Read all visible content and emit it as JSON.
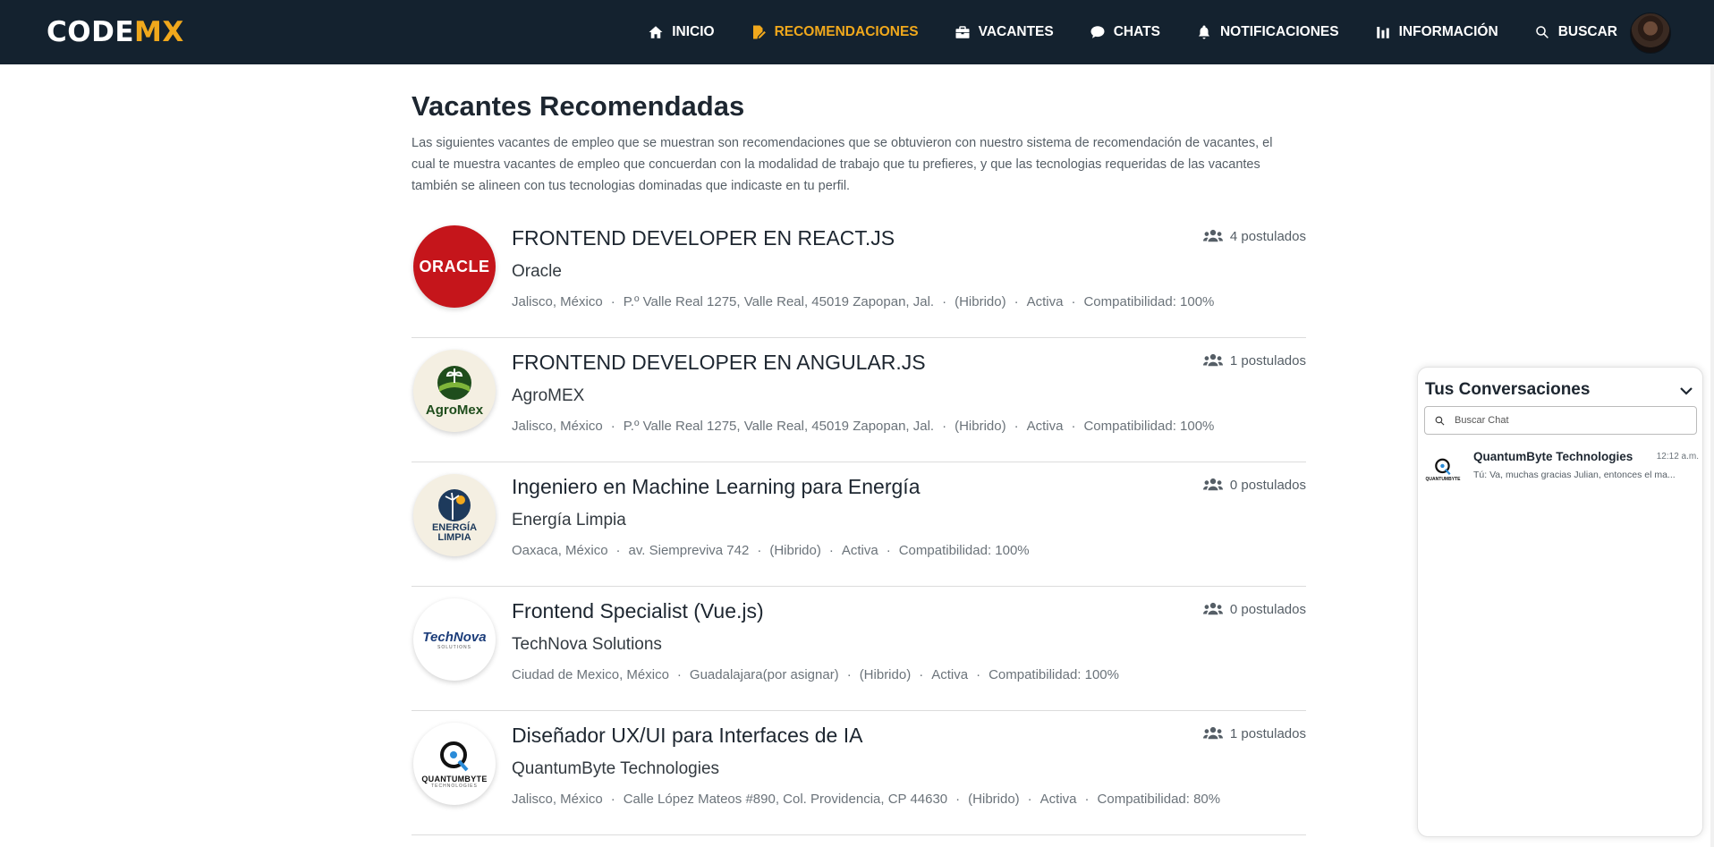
{
  "brand": {
    "part1": "CODE",
    "part2": "MX"
  },
  "nav": [
    {
      "label": "INICIO",
      "icon": "home-icon",
      "active": false
    },
    {
      "label": "RECOMENDACIONES",
      "icon": "edit-doc-icon",
      "active": true
    },
    {
      "label": "VACANTES",
      "icon": "briefcase-icon",
      "active": false
    },
    {
      "label": "CHATS",
      "icon": "chat-bubble-icon",
      "active": false
    },
    {
      "label": "NOTIFICACIONES",
      "icon": "bell-icon",
      "active": false
    },
    {
      "label": "INFORMACIÓN",
      "icon": "bar-chart-icon",
      "active": false
    },
    {
      "label": "BUSCAR",
      "icon": "search-icon",
      "active": false
    }
  ],
  "page": {
    "title": "Vacantes Recomendadas",
    "description": "Las siguientes vacantes de empleo que se muestran son recomendaciones que se obtuvieron con nuestro sistema de recomendación de vacantes, el cual te muestra vacantes de empleo que concuerdan con la modalidad de trabajo que tu prefieres, y que las tecnologias requeridas de las vacantes también se alineen con tus tecnologias dominadas que indicaste en tu perfil."
  },
  "jobs": [
    {
      "title": "FRONTEND DEVELOPER EN REACT.JS",
      "company": "Oracle",
      "location": "Jalisco, México",
      "address": "P.º Valle Real 1275, Valle Real, 45019 Zapopan, Jal.",
      "modality": "(Hibrido)",
      "status": "Activa",
      "compat": "Compatibilidad: 100%",
      "applicants": "4 postulados",
      "logo_text": "ORACLE"
    },
    {
      "title": "FRONTEND DEVELOPER EN ANGULAR.JS",
      "company": "AgroMEX",
      "location": "Jalisco, México",
      "address": "P.º Valle Real 1275, Valle Real, 45019 Zapopan, Jal.",
      "modality": "(Hibrido)",
      "status": "Activa",
      "compat": "Compatibilidad: 100%",
      "applicants": "1 postulados",
      "logo_text": "AgroMex"
    },
    {
      "title": "Ingeniero en Machine Learning para Energía",
      "company": "Energía Limpia",
      "location": "Oaxaca, México",
      "address": "av. Siempreviva 742",
      "modality": "(Hibrido)",
      "status": "Activa",
      "compat": "Compatibilidad: 100%",
      "applicants": "0 postulados",
      "logo_text_1": "ENERGÍA",
      "logo_text_2": "LIMPIA"
    },
    {
      "title": "Frontend Specialist (Vue.js)",
      "company": "TechNova Solutions",
      "location": "Ciudad de Mexico, México",
      "address": "Guadalajara(por asignar)",
      "modality": "(Hibrido)",
      "status": "Activa",
      "compat": "Compatibilidad: 100%",
      "applicants": "0 postulados",
      "logo_text": "TechNova",
      "logo_sub": "SOLUTIONS"
    },
    {
      "title": "Diseñador UX/UI para Interfaces de IA",
      "company": "QuantumByte Technologies",
      "location": "Jalisco, México",
      "address": "Calle López Mateos #890, Col. Providencia, CP 44630",
      "modality": "(Hibrido)",
      "status": "Activa",
      "compat": "Compatibilidad: 80%",
      "applicants": "1 postulados",
      "logo_text": "QUANTUMBYTE",
      "logo_sub": "TECHNOLOGIES"
    }
  ],
  "chat": {
    "title": "Tus Conversaciones",
    "search_placeholder": "Buscar Chat",
    "conversations": [
      {
        "name": "QuantumByte Technologies",
        "time": "12:12 a.m.",
        "message": "Tú: Va, muchas gracias Julian, entonces el ma...",
        "logo_text": "QUANTUMBYTE"
      }
    ]
  },
  "colors": {
    "navbar": "#14222f",
    "accent": "#f0a81c",
    "oracle_red": "#c5151b"
  }
}
